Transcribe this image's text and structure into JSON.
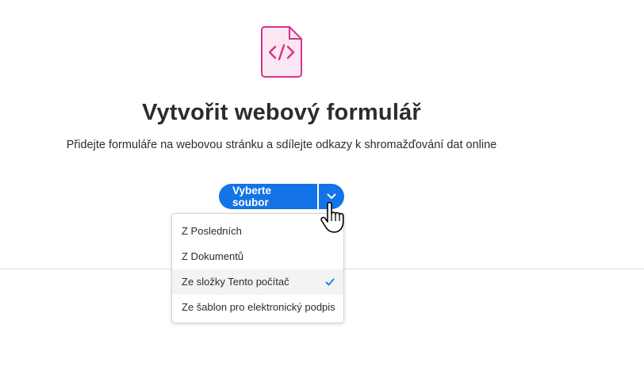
{
  "main": {
    "title": "Vytvořit webový formulář",
    "subtitle": "Přidejte formuláře na webovou stránku a sdílejte odkazy k shromažďování dat online",
    "file_icon": "code-file-icon",
    "accent_color": "#1473e6",
    "icon_color": "#d6338f"
  },
  "split_button": {
    "label": "Vyberte soubor",
    "dropdown_icon": "chevron-down-icon"
  },
  "menu": {
    "items": [
      {
        "label": "Z Posledních",
        "selected": false
      },
      {
        "label": "Z Dokumentů",
        "selected": false
      },
      {
        "label": "Ze složky Tento počítač",
        "selected": true,
        "icon": "checkmark-icon"
      },
      {
        "label": "Ze šablon pro elektronický podpis",
        "selected": false
      }
    ]
  },
  "pointer": "hand-pointer-cursor"
}
